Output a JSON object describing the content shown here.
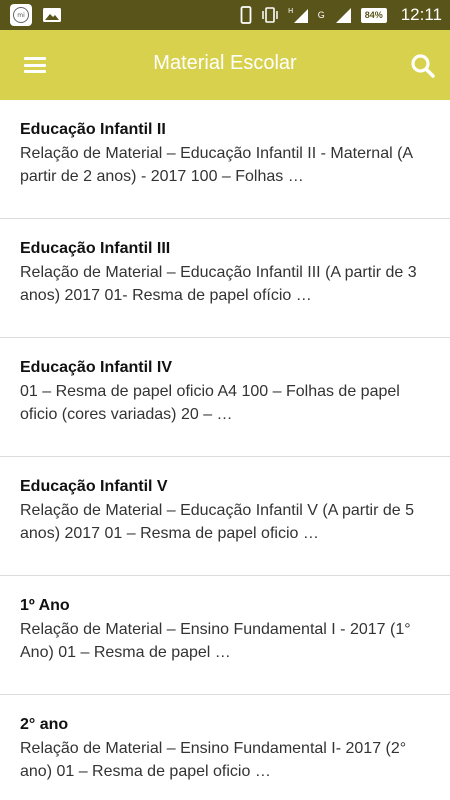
{
  "status_bar": {
    "network_label": "G",
    "network_sub_1": "1",
    "network_sub_2": "2",
    "battery": "84%",
    "time": "12:11",
    "notification_icon": "app-notification-icon",
    "gallery_icon": "gallery-icon"
  },
  "app_bar": {
    "title": "Material Escolar",
    "menu_icon": "menu-icon",
    "search_icon": "search-icon",
    "color": "#d8d14e"
  },
  "posts": [
    {
      "title": "Educação Infantil II",
      "excerpt": "Relação de Material – Educação Infantil II - Maternal (A partir de 2 anos) - 2017 100 – Folhas …"
    },
    {
      "title": "Educação Infantil III",
      "excerpt": "Relação de Material – Educação Infantil III (A partir de 3 anos) 2017 01- Resma de papel ofício …"
    },
    {
      "title": "Educação Infantil IV",
      "excerpt": "01 – Resma de papel oficio A4   100 – Folhas de papel oficio (cores variadas) 20 – …"
    },
    {
      "title": "Educação Infantil V",
      "excerpt": "Relação de Material – Educação Infantil V (A partir de 5 anos) 2017 01 – Resma de papel oficio …"
    },
    {
      "title": "1º Ano",
      "excerpt": "Relação de Material – Ensino Fundamental I -  2017 (1° Ano)  01 – Resma de papel …"
    },
    {
      "title": "2° ano",
      "excerpt": "Relação de Material – Ensino Fundamental I- 2017 (2° ano) 01 – Resma de papel oficio …"
    }
  ]
}
